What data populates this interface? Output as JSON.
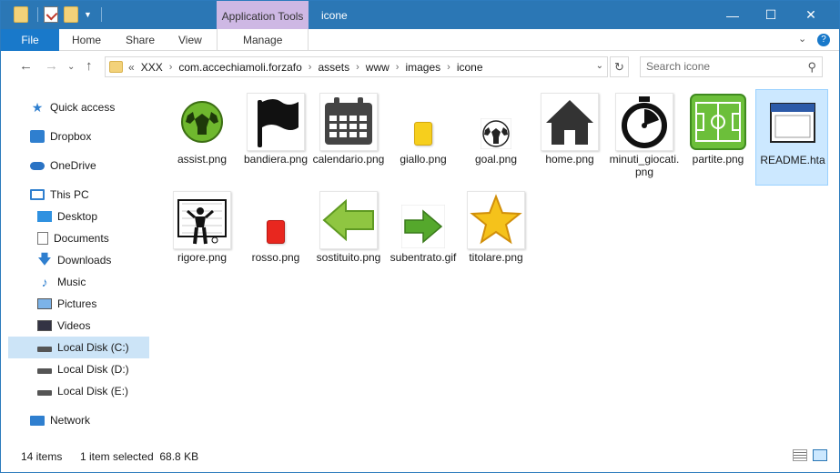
{
  "window": {
    "title": "icone",
    "context_tab": "Application Tools",
    "controls": {
      "minimize": "—",
      "maximize": "☐",
      "close": "✕"
    }
  },
  "ribbon": {
    "tabs": [
      {
        "label": "File"
      },
      {
        "label": "Home"
      },
      {
        "label": "Share"
      },
      {
        "label": "View"
      },
      {
        "label": "Manage"
      }
    ],
    "expand_icon": "⌄",
    "help_icon": "?"
  },
  "address": {
    "overflow": "«",
    "crumbs": [
      "XXX",
      "com.accechiamoli.forzafo",
      "assets",
      "www",
      "images",
      "icone"
    ],
    "dropdown": "⌄",
    "refresh": "↻"
  },
  "search": {
    "placeholder": "Search icone",
    "icon": "⚲"
  },
  "nav": {
    "back": "←",
    "forward": "→",
    "recent": "⌄",
    "up": "↑"
  },
  "sidebar": [
    {
      "label": "Quick access",
      "icon": "star-icon"
    },
    {
      "label": "Dropbox",
      "icon": "dropbox-icon"
    },
    {
      "label": "OneDrive",
      "icon": "cloud-icon"
    },
    {
      "label": "This PC",
      "icon": "computer-icon"
    },
    {
      "label": "Desktop",
      "icon": "desktop-icon"
    },
    {
      "label": "Documents",
      "icon": "documents-icon"
    },
    {
      "label": "Downloads",
      "icon": "downloads-icon"
    },
    {
      "label": "Music",
      "icon": "music-icon"
    },
    {
      "label": "Pictures",
      "icon": "pictures-icon"
    },
    {
      "label": "Videos",
      "icon": "videos-icon"
    },
    {
      "label": "Local Disk (C:)",
      "icon": "drive-icon",
      "selected": true
    },
    {
      "label": "Local Disk (D:)",
      "icon": "drive-icon"
    },
    {
      "label": "Local Disk (E:)",
      "icon": "drive-icon"
    },
    {
      "label": "Network",
      "icon": "network-icon"
    }
  ],
  "files": [
    {
      "name": "assist.png",
      "icon": "soccer-ball-green-icon"
    },
    {
      "name": "bandiera.png",
      "icon": "flag-icon"
    },
    {
      "name": "calendario.png",
      "icon": "calendar-icon"
    },
    {
      "name": "giallo.png",
      "icon": "yellow-card-icon"
    },
    {
      "name": "goal.png",
      "icon": "soccer-ball-icon"
    },
    {
      "name": "home.png",
      "icon": "home-icon"
    },
    {
      "name": "minuti_giocati.png",
      "icon": "stopwatch-icon"
    },
    {
      "name": "partite.png",
      "icon": "soccer-field-icon"
    },
    {
      "name": "README.hta",
      "icon": "hta-application-icon",
      "selected": true
    },
    {
      "name": "rigore.png",
      "icon": "penalty-icon"
    },
    {
      "name": "rosso.png",
      "icon": "red-card-icon"
    },
    {
      "name": "sostituito.png",
      "icon": "left-arrow-icon"
    },
    {
      "name": "subentrato.gif",
      "icon": "right-arrow-icon"
    },
    {
      "name": "titolare.png",
      "icon": "star-gold-icon"
    }
  ],
  "status": {
    "count": "14 items",
    "selection": "1 item selected  68.8 KB"
  },
  "colors": {
    "titlebar": "#2b77b5",
    "context_tab": "#ceb8e4",
    "file_tab": "#1979ca",
    "selection": "#cce8ff"
  }
}
